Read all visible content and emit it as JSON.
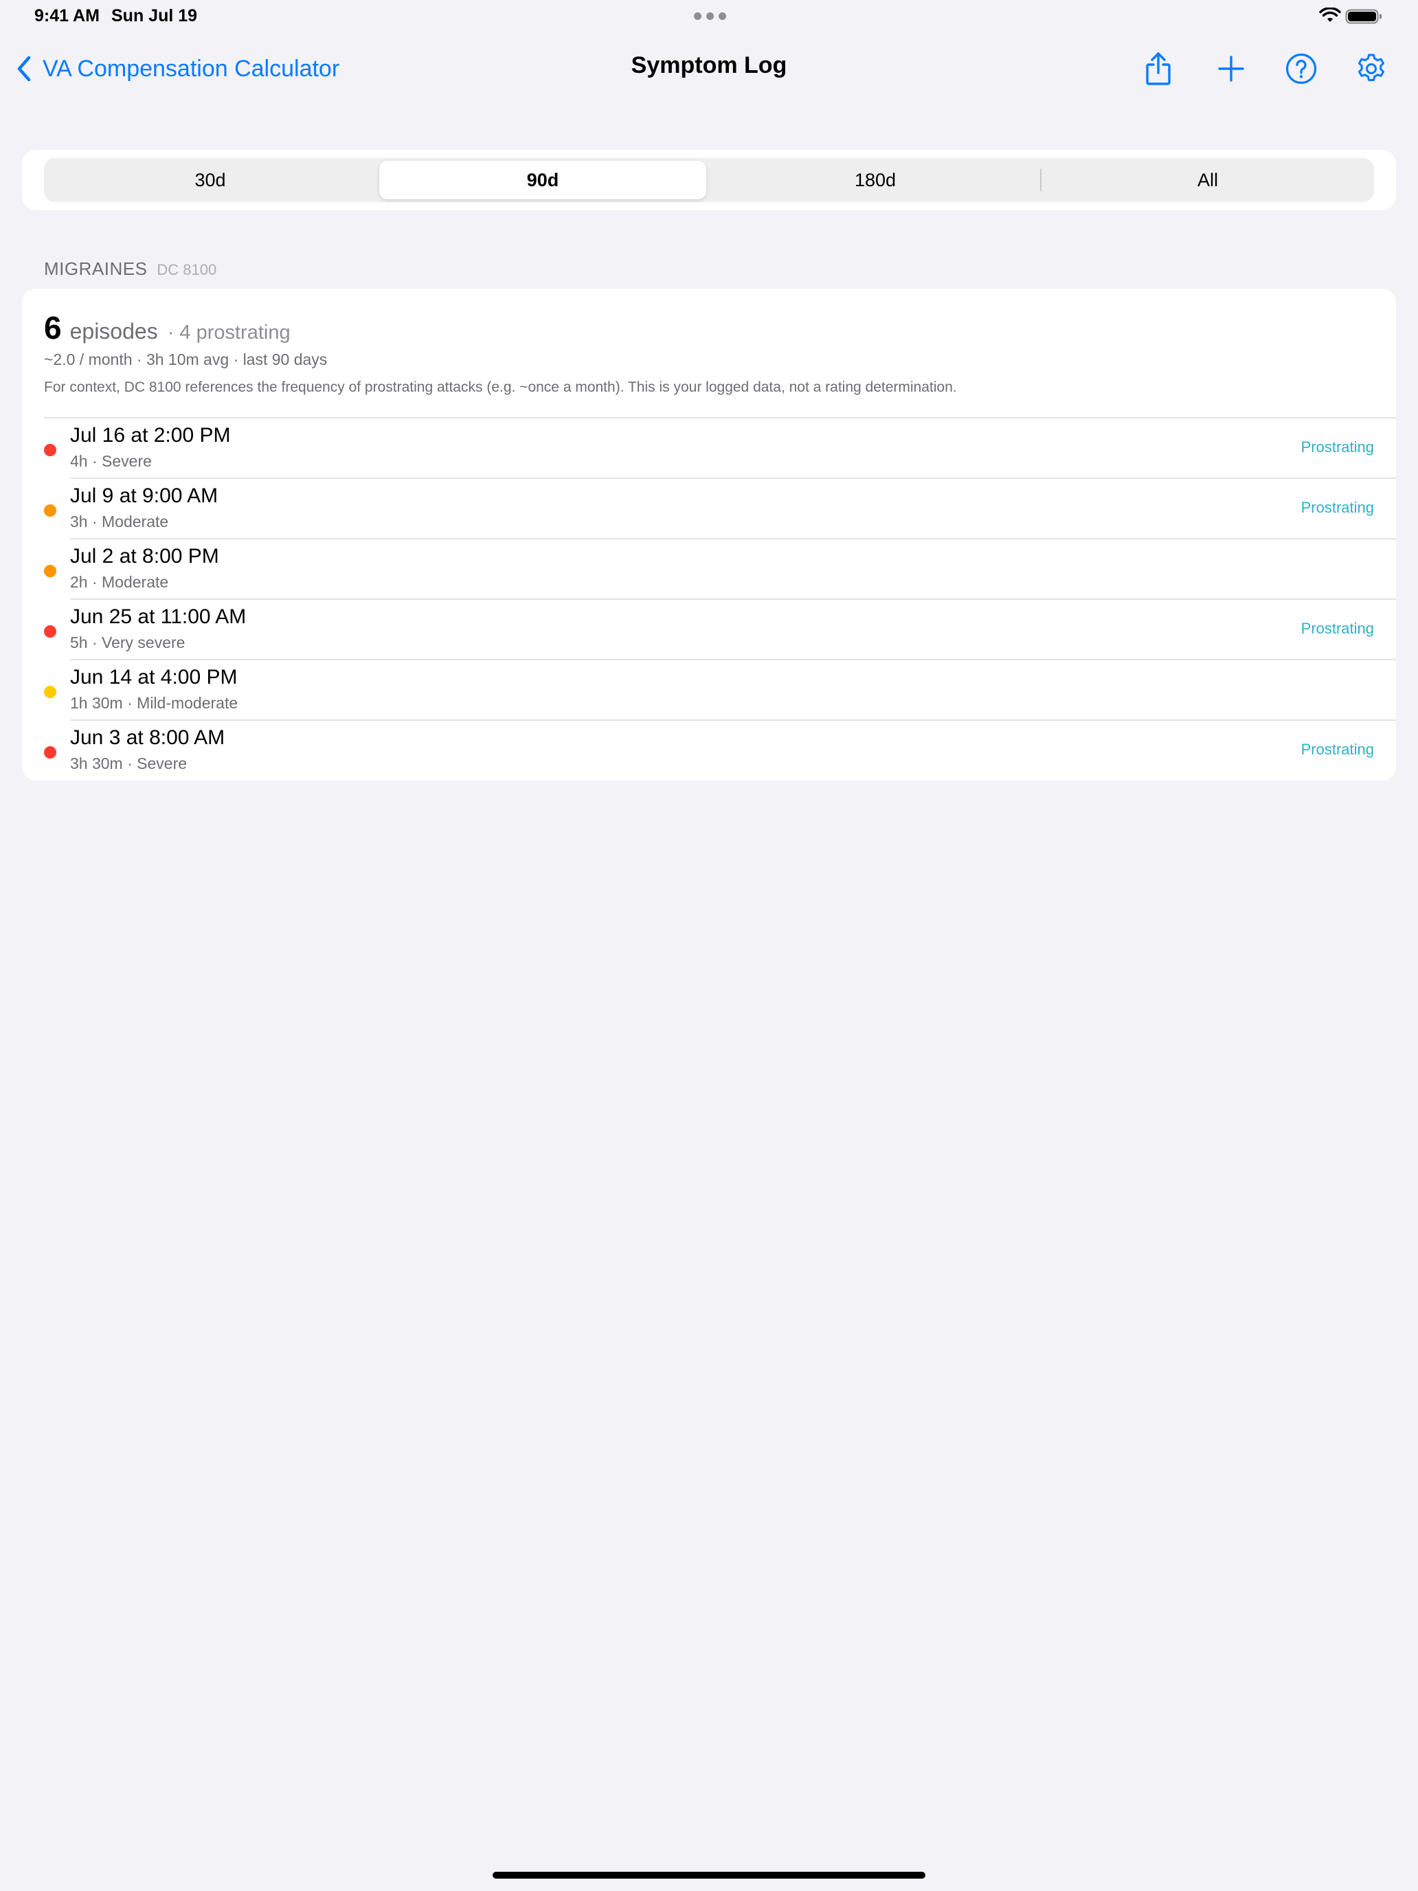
{
  "status_bar": {
    "time": "9:41 AM",
    "date": "Sun Jul 19"
  },
  "nav": {
    "back_label": "VA Compensation Calculator",
    "title": "Symptom Log",
    "actions": [
      "share-icon",
      "plus-icon",
      "help-icon",
      "gear-icon"
    ]
  },
  "range_selector": {
    "options": [
      "30d",
      "90d",
      "180d",
      "All"
    ],
    "selected": "90d"
  },
  "section": {
    "title": "MIGRAINES",
    "code": "DC 8100"
  },
  "summary": {
    "count": "6",
    "count_label": "episodes",
    "prostrating": "· 4 prostrating",
    "stats": "~2.0 / month · 3h 10m avg · last 90 days",
    "note": "For context, DC 8100 references the frequency of prostrating attacks (e.g. ~once a month). This is your logged data, not a rating determination."
  },
  "entries": [
    {
      "date": "Jul 16 at 2:00 PM",
      "detail": "4h · Severe",
      "tag": "Prostrating",
      "color": "#ff3b30"
    },
    {
      "date": "Jul 9 at 9:00 AM",
      "detail": "3h · Moderate",
      "tag": "Prostrating",
      "color": "#ff9500"
    },
    {
      "date": "Jul 2 at 8:00 PM",
      "detail": "2h · Moderate",
      "tag": "",
      "color": "#ff9500"
    },
    {
      "date": "Jun 25 at 11:00 AM",
      "detail": "5h · Very severe",
      "tag": "Prostrating",
      "color": "#ff3b30"
    },
    {
      "date": "Jun 14 at 4:00 PM",
      "detail": "1h 30m · Mild-moderate",
      "tag": "",
      "color": "#ffcc00"
    },
    {
      "date": "Jun 3 at 8:00 AM",
      "detail": "3h 30m · Severe",
      "tag": "Prostrating",
      "color": "#ff3b30"
    }
  ],
  "colors": {
    "accent": "#0a7aff",
    "tag": "#30b0c7",
    "background": "#f2f2f7"
  }
}
